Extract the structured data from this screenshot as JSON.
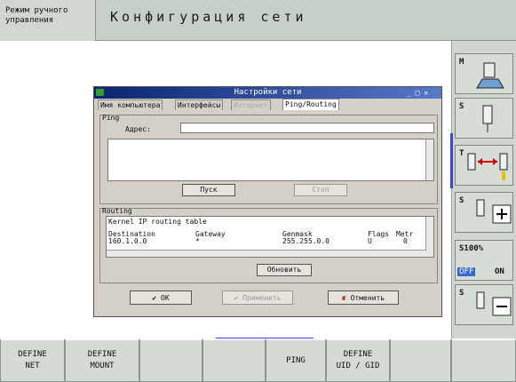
{
  "header": {
    "mode_label": "Режим ручного управления",
    "title": "Конфигурация сети"
  },
  "dialog": {
    "title": "Настройки сети",
    "tabs": [
      {
        "label": "Имя компьютера"
      },
      {
        "label": "Интерфейсы"
      },
      {
        "label": "Интернет"
      },
      {
        "label": "Ping/Routing"
      }
    ],
    "ping": {
      "group_label": "Ping",
      "address_label": "Адрес:",
      "address_value": "",
      "start_button": "Пуск",
      "stop_button": "Стоп"
    },
    "routing": {
      "group_label": "Routing",
      "table_title": "Kernel IP routing table",
      "headers": [
        "Destination",
        "Gateway",
        "Genmask",
        "Flags",
        "Metr"
      ],
      "row": [
        "160.1.0.0",
        "*",
        "255.255.0.0",
        "U",
        "0"
      ],
      "refresh_button": "Обновить"
    },
    "buttons": {
      "ok": "OK",
      "apply": "Применить",
      "cancel": "Отменить"
    }
  },
  "sidebar": {
    "items": [
      {
        "label": "M"
      },
      {
        "label": "S"
      },
      {
        "label": "T"
      },
      {
        "label": "S"
      },
      {
        "label": "S100%",
        "off": "OFF",
        "on": "ON"
      },
      {
        "label": "S"
      }
    ]
  },
  "softkeys": [
    {
      "line1": "DEFINE",
      "line2": "NET"
    },
    {
      "line1": "DEFINE",
      "line2": "MOUNT"
    },
    {
      "line1": "",
      "line2": ""
    },
    {
      "line1": "",
      "line2": ""
    },
    {
      "line1": "PING",
      "line2": ""
    },
    {
      "line1": "DEFINE",
      "line2": "UID / GID"
    },
    {
      "line1": "",
      "line2": ""
    }
  ]
}
